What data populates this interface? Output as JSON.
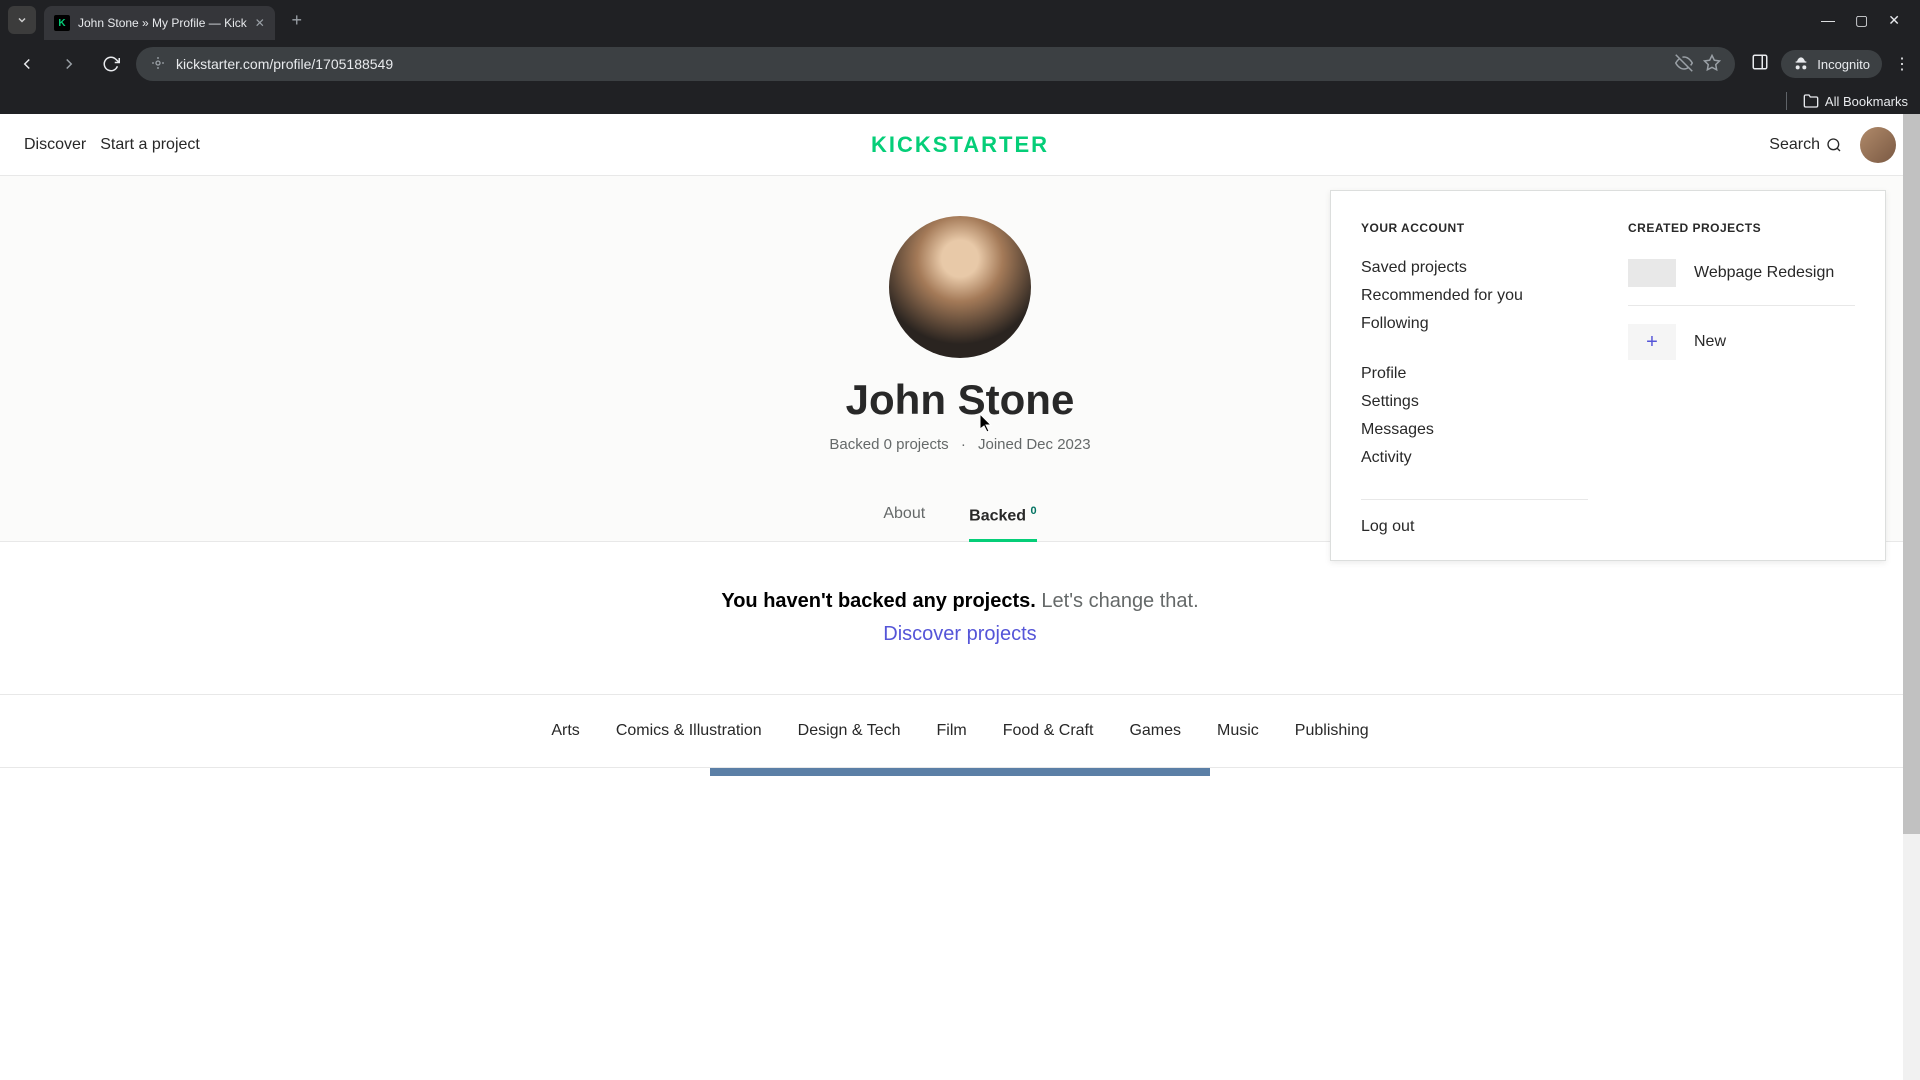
{
  "browser": {
    "tab_title": "John Stone » My Profile — Kick",
    "url": "kickstarter.com/profile/1705188549",
    "incognito_label": "Incognito",
    "all_bookmarks": "All Bookmarks"
  },
  "header": {
    "discover": "Discover",
    "start_project": "Start a project",
    "logo": "KICKSTARTER",
    "search": "Search"
  },
  "profile": {
    "name": "John Stone",
    "backed_text": "Backed 0 projects",
    "joined_text": "Joined Dec 2023"
  },
  "tabs": {
    "about": "About",
    "backed": "Backed",
    "backed_count": "0"
  },
  "empty": {
    "bold": "You haven't backed any projects.",
    "light": " Let's change that.",
    "link": "Discover projects"
  },
  "footer": [
    "Arts",
    "Comics & Illustration",
    "Design & Tech",
    "Film",
    "Food & Craft",
    "Games",
    "Music",
    "Publishing"
  ],
  "dropdown": {
    "account_heading": "YOUR ACCOUNT",
    "links1": [
      "Saved projects",
      "Recommended for you",
      "Following"
    ],
    "links2": [
      "Profile",
      "Settings",
      "Messages",
      "Activity"
    ],
    "logout": "Log out",
    "created_heading": "CREATED PROJECTS",
    "project1": "Webpage Redesign",
    "new_label": "New"
  }
}
